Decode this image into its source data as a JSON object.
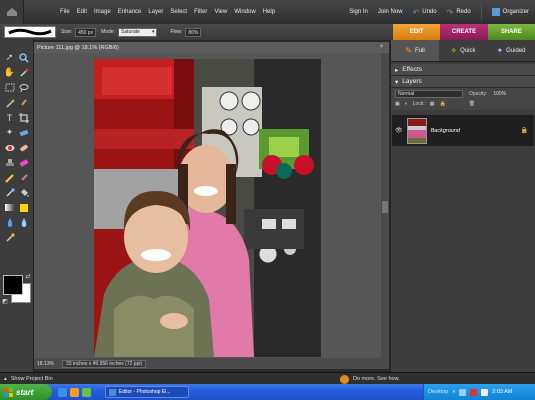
{
  "menubar": {
    "items": [
      "File",
      "Edit",
      "Image",
      "Enhance",
      "Layer",
      "Select",
      "Filter",
      "View",
      "Window",
      "Help"
    ],
    "sign_in": "Sign In",
    "join_now": "Join Now",
    "undo": "Undo",
    "redo": "Redo",
    "organizer": "Organizer"
  },
  "options": {
    "size_label": "Size:",
    "size_value": "450 px",
    "mode_label": "Mode:",
    "mode_value": "Saturate",
    "flow_label": "Flow:",
    "flow_value": "80%"
  },
  "mode_tabs": [
    "EDIT",
    "CREATE",
    "SHARE"
  ],
  "edit_tabs": [
    "Full",
    "Quick",
    "Guided"
  ],
  "document": {
    "title": "Picture 111.jpg @ 18.1% (RGB/8)",
    "zoom": "18.13%",
    "doc_size": "33 inches x 49.556 inches (72 ppi)"
  },
  "panels": {
    "effects": "Effects",
    "layers": "Layers",
    "blend_mode": "Normal",
    "opacity_label": "Opacity:",
    "opacity_value": "100%",
    "lock_label": "Lock:",
    "layer_name": "Background"
  },
  "bottom": {
    "show_project_bin": "Show Project Bin",
    "do_more": "Do more. See how."
  },
  "taskbar": {
    "start": "start",
    "task": "Editor - Photoshop El...",
    "desktop": "Desktop",
    "time": "2:03 AM"
  },
  "colors": {
    "accent_edit": "#e08a1a",
    "accent_create": "#a02568",
    "accent_share": "#5fa02e",
    "foreground_swatch": "#000000",
    "background_swatch": "#ffffff"
  }
}
